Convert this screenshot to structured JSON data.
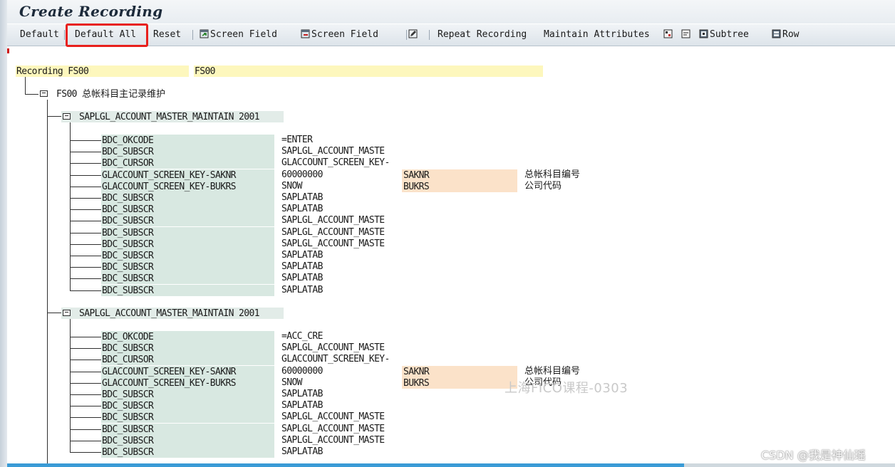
{
  "window": {
    "title": "Create Recording"
  },
  "toolbar": {
    "default": "Default",
    "default_all": "Default All",
    "reset": "Reset",
    "screen_field_1": "Screen Field",
    "screen_field_2": "Screen Field",
    "repeat_recording": "Repeat Recording",
    "maintain_attributes": "Maintain Attributes",
    "subtree": "Subtree",
    "row": "Row",
    "highlight_color": "#e8201c"
  },
  "recording": {
    "label": "Recording FS00",
    "value": "FS00",
    "transaction": {
      "code": "FS00",
      "desc": "总帐科目主记录维护"
    },
    "screens": [
      {
        "title": "SAPLGL_ACCOUNT_MASTER_MAINTAIN 2001",
        "fields": [
          {
            "name": "BDC_OKCODE",
            "value": "=ENTER",
            "tech": "",
            "desc": ""
          },
          {
            "name": "BDC_SUBSCR",
            "value": "SAPLGL_ACCOUNT_MASTE",
            "tech": "",
            "desc": ""
          },
          {
            "name": "BDC_CURSOR",
            "value": "GLACCOUNT_SCREEN_KEY-",
            "tech": "",
            "desc": ""
          },
          {
            "name": "GLACCOUNT_SCREEN_KEY-SAKNR",
            "value": "60000000",
            "tech": "SAKNR",
            "desc": "总帐科目编号"
          },
          {
            "name": "GLACCOUNT_SCREEN_KEY-BUKRS",
            "value": "SNOW",
            "tech": "BUKRS",
            "desc": "公司代码"
          },
          {
            "name": "BDC_SUBSCR",
            "value": "SAPLATAB",
            "tech": "",
            "desc": ""
          },
          {
            "name": "BDC_SUBSCR",
            "value": "SAPLATAB",
            "tech": "",
            "desc": ""
          },
          {
            "name": "BDC_SUBSCR",
            "value": "SAPLGL_ACCOUNT_MASTE",
            "tech": "",
            "desc": ""
          },
          {
            "name": "BDC_SUBSCR",
            "value": "SAPLGL_ACCOUNT_MASTE",
            "tech": "",
            "desc": ""
          },
          {
            "name": "BDC_SUBSCR",
            "value": "SAPLGL_ACCOUNT_MASTE",
            "tech": "",
            "desc": ""
          },
          {
            "name": "BDC_SUBSCR",
            "value": "SAPLATAB",
            "tech": "",
            "desc": ""
          },
          {
            "name": "BDC_SUBSCR",
            "value": "SAPLATAB",
            "tech": "",
            "desc": ""
          },
          {
            "name": "BDC_SUBSCR",
            "value": "SAPLATAB",
            "tech": "",
            "desc": ""
          },
          {
            "name": "BDC_SUBSCR",
            "value": "SAPLATAB",
            "tech": "",
            "desc": ""
          }
        ]
      },
      {
        "title": "SAPLGL_ACCOUNT_MASTER_MAINTAIN 2001",
        "fields": [
          {
            "name": "BDC_OKCODE",
            "value": "=ACC_CRE",
            "tech": "",
            "desc": ""
          },
          {
            "name": "BDC_SUBSCR",
            "value": "SAPLGL_ACCOUNT_MASTE",
            "tech": "",
            "desc": ""
          },
          {
            "name": "BDC_CURSOR",
            "value": "GLACCOUNT_SCREEN_KEY-",
            "tech": "",
            "desc": ""
          },
          {
            "name": "GLACCOUNT_SCREEN_KEY-SAKNR",
            "value": "60000000",
            "tech": "SAKNR",
            "desc": "总帐科目编号"
          },
          {
            "name": "GLACCOUNT_SCREEN_KEY-BUKRS",
            "value": "SNOW",
            "tech": "BUKRS",
            "desc": "公司代码"
          },
          {
            "name": "BDC_SUBSCR",
            "value": "SAPLATAB",
            "tech": "",
            "desc": ""
          },
          {
            "name": "BDC_SUBSCR",
            "value": "SAPLATAB",
            "tech": "",
            "desc": ""
          },
          {
            "name": "BDC_SUBSCR",
            "value": "SAPLGL_ACCOUNT_MASTE",
            "tech": "",
            "desc": ""
          },
          {
            "name": "BDC_SUBSCR",
            "value": "SAPLGL_ACCOUNT_MASTE",
            "tech": "",
            "desc": ""
          },
          {
            "name": "BDC_SUBSCR",
            "value": "SAPLGL_ACCOUNT_MASTE",
            "tech": "",
            "desc": ""
          },
          {
            "name": "BDC_SUBSCR",
            "value": "SAPLATAB",
            "tech": "",
            "desc": ""
          }
        ]
      }
    ]
  },
  "overlay": {
    "watermark": "上海FICO课程-0303",
    "csdn": "CSDN @我是神仙瑶"
  }
}
